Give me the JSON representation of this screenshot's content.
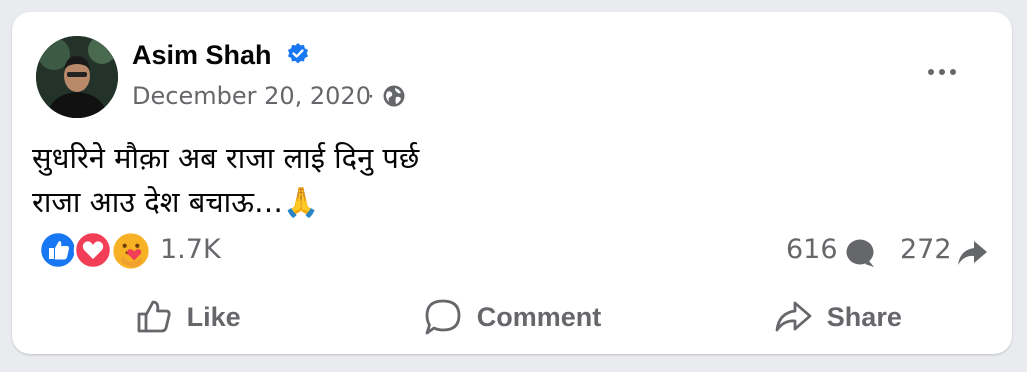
{
  "post": {
    "author": "Asim Shah",
    "date": "December 20, 2020",
    "separator": "·",
    "text_lines": [
      "सुधरिने मौक़ा अब राजा लाई दिनु पर्छ",
      "राजा आउ देश बचाऊ…🙏"
    ]
  },
  "icons": {
    "verified": "verified-badge-icon",
    "privacy": "globe-icon",
    "more": "more-options-icon",
    "reactions": [
      "like-reaction-icon",
      "love-reaction-icon",
      "care-reaction-icon"
    ],
    "comment": "comment-bubble-icon",
    "share": "share-arrow-icon",
    "like_action": "thumbs-up-icon",
    "comment_action": "comment-icon",
    "share_action": "share-icon"
  },
  "stats": {
    "reactions": "1.7K",
    "comments": "616",
    "shares": "272"
  },
  "actions": {
    "like": "Like",
    "comment": "Comment",
    "share": "Share"
  },
  "colors": {
    "verified": "#1877f2",
    "like": "#1877f2",
    "love": "#f33e58",
    "care": "#f7b125",
    "muted": "#65676b",
    "text": "#050505"
  }
}
